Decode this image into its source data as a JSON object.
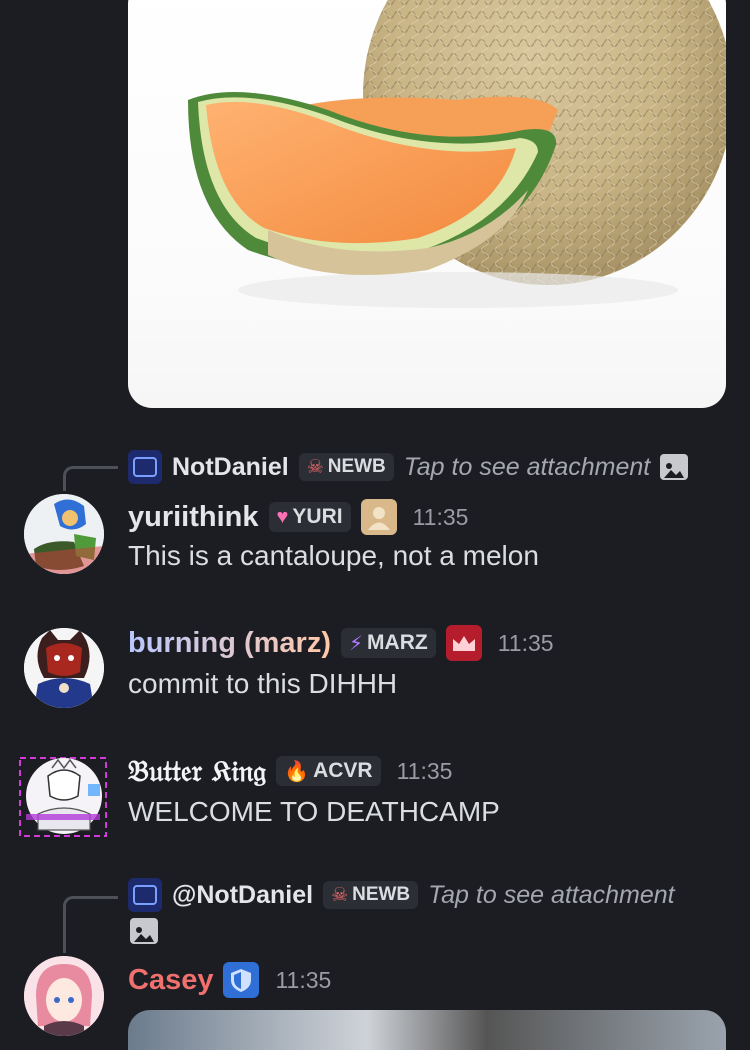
{
  "messages": [
    {
      "reply": {
        "author": "NotDaniel",
        "tag": "NEWB",
        "text": "Tap to see attachment"
      },
      "author": "yuriithink",
      "tag": "YURI",
      "time": "11:35",
      "text": "This is a cantaloupe, not a melon",
      "name_color": "#e3e5e8"
    },
    {
      "author": "burning (marz)",
      "tag": "MARZ",
      "time": "11:35",
      "text": "commit to this DIHHH"
    },
    {
      "author": "𝔅𝔲𝔱𝔱𝔢𝔯 𝔎𝔦𝔫𝔤",
      "tag": "ACVR",
      "time": "11:35",
      "text": "WELCOME TO DEATHCAMP"
    },
    {
      "reply": {
        "author": "@NotDaniel",
        "tag": "NEWB",
        "text": "Tap to see attachment"
      },
      "author": "Casey",
      "time": "11:35",
      "name_color": "#f0706e"
    }
  ],
  "icons": {
    "newb_badge": "skull-icon",
    "yuri_badge": "heart-icon",
    "marz_badge": "lightning-icon",
    "acvr_badge": "fire-cat-icon",
    "attachment_icon": "image-icon"
  }
}
